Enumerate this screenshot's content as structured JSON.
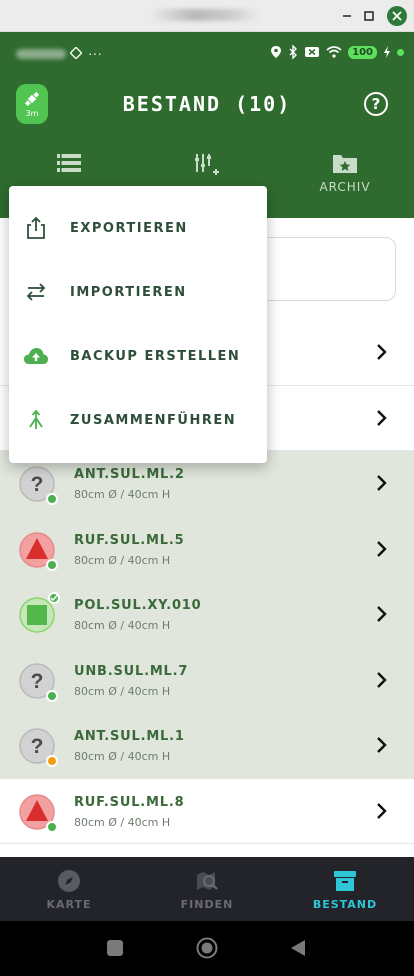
{
  "status_bar": {
    "battery": "100"
  },
  "header": {
    "gps_label": "3m",
    "title": "BESTAND (10)",
    "help_label": "?"
  },
  "tabs": [
    {
      "icon": "list-icon",
      "label": ""
    },
    {
      "icon": "filter-add-icon",
      "label": ""
    },
    {
      "icon": "folder-star-icon",
      "label": "ARCHIV"
    }
  ],
  "menu": {
    "items": [
      {
        "icon": "share-export-icon",
        "label": "EXPORTIEREN"
      },
      {
        "icon": "swap-arrows-icon",
        "label": "IMPORTIEREN"
      },
      {
        "icon": "cloud-upload-icon",
        "label": "BACKUP ERSTELLEN"
      },
      {
        "icon": "merge-icon",
        "label": "ZUSAMMENFÜHREN"
      }
    ]
  },
  "items": [
    {
      "name": "",
      "size": "",
      "type": "hidden"
    },
    {
      "name": "",
      "size": "",
      "type": "hidden"
    },
    {
      "name": "ANT.SUL.ML.2",
      "size": "80cm Ø / 40cm H",
      "type": "question",
      "dot": "#4caf50",
      "highlight": true
    },
    {
      "name": "RUF.SUL.ML.5",
      "size": "80cm Ø / 40cm H",
      "type": "triangle",
      "dot": "#4caf50",
      "highlight": true
    },
    {
      "name": "POL.SUL.XY.010",
      "size": "80cm Ø / 40cm H",
      "type": "square",
      "dot": "#4caf50",
      "highlight": true
    },
    {
      "name": "UNB.SUL.ML.7",
      "size": "80cm Ø / 40cm H",
      "type": "question",
      "dot": "#4caf50",
      "highlight": true
    },
    {
      "name": "ANT.SUL.ML.1",
      "size": "80cm Ø / 40cm H",
      "type": "question",
      "dot": "#f39c12",
      "highlight": true
    },
    {
      "name": "RUF.SUL.ML.8",
      "size": "80cm Ø / 40cm H",
      "type": "triangle",
      "dot": "#4caf50",
      "highlight": false
    }
  ],
  "bottom_nav": [
    {
      "icon": "compass-icon",
      "label": "KARTE",
      "active": false
    },
    {
      "icon": "search-map-icon",
      "label": "FINDEN",
      "active": false
    },
    {
      "icon": "archive-box-icon",
      "label": "BESTAND",
      "active": true
    }
  ],
  "colors": {
    "header_bg": "#2f6b2f",
    "accent": "#52c452",
    "active_nav": "#2ec7d8"
  }
}
